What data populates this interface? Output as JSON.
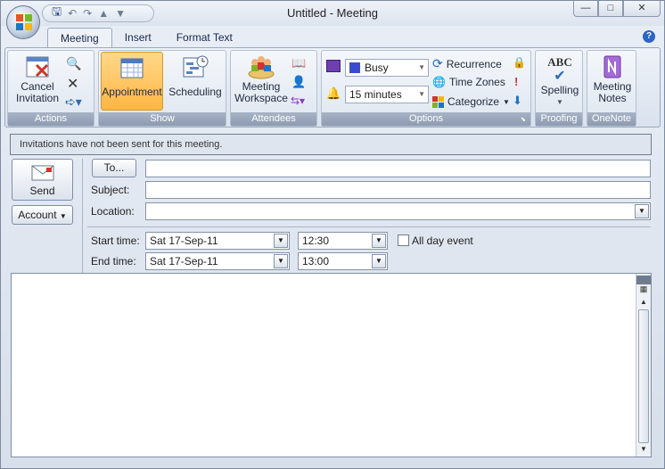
{
  "window": {
    "title": "Untitled - Meeting",
    "min_label": "—",
    "max_label": "□",
    "close_label": "✕"
  },
  "tabs": [
    {
      "label": "Meeting",
      "active": true
    },
    {
      "label": "Insert",
      "active": false
    },
    {
      "label": "Format Text",
      "active": false
    }
  ],
  "ribbon": {
    "actions": {
      "cancel_label_1": "Cancel",
      "cancel_label_2": "Invitation",
      "group_label": "Actions"
    },
    "show": {
      "appointment_label": "Appointment",
      "scheduling_label": "Scheduling",
      "group_label": "Show"
    },
    "attendees": {
      "workspace_label_1": "Meeting",
      "workspace_label_2": "Workspace",
      "group_label": "Attendees"
    },
    "options": {
      "show_as": "Busy",
      "reminder": "15 minutes",
      "recurrence_label": "Recurrence",
      "timezones_label": "Time Zones",
      "categorize_label": "Categorize",
      "group_label": "Options"
    },
    "proofing": {
      "spelling_label": "Spelling",
      "group_label": "Proofing",
      "abc": "ABC"
    },
    "onenote": {
      "notes_label_1": "Meeting",
      "notes_label_2": "Notes",
      "group_label": "OneNote"
    }
  },
  "infobar": {
    "text": "Invitations have not been sent for this meeting."
  },
  "form": {
    "send_label": "Send",
    "account_label": "Account",
    "to_button": "To...",
    "to_value": "",
    "subject_label": "Subject:",
    "subject_value": "",
    "location_label": "Location:",
    "location_value": "",
    "start_label": "Start time:",
    "start_date": "Sat 17-Sep-11",
    "start_time": "12:30",
    "end_label": "End time:",
    "end_date": "Sat 17-Sep-11",
    "end_time": "13:00",
    "all_day_label": "All day event",
    "all_day_checked": false
  },
  "colors": {
    "accent": "#ffb642",
    "ribbon_label": "#8e9bb1",
    "help": "#2c64c4"
  }
}
